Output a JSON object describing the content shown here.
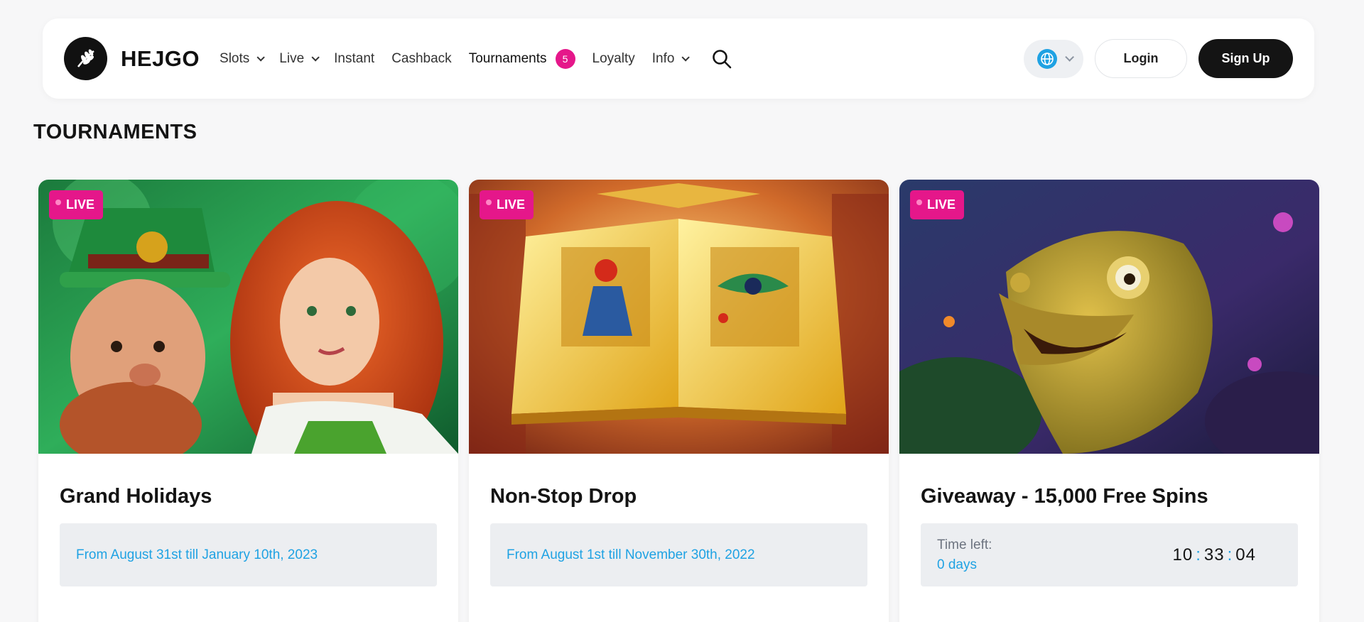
{
  "header": {
    "logo_text": "HEJGO",
    "nav": [
      {
        "label": "Slots",
        "dropdown": true
      },
      {
        "label": "Live",
        "dropdown": true
      },
      {
        "label": "Instant",
        "dropdown": false
      },
      {
        "label": "Cashback",
        "dropdown": false
      },
      {
        "label": "Tournaments",
        "dropdown": false,
        "badge": "5"
      },
      {
        "label": "Loyalty",
        "dropdown": false
      },
      {
        "label": "Info",
        "dropdown": true
      }
    ],
    "login_label": "Login",
    "signup_label": "Sign Up"
  },
  "page_title": "TOURNAMENTS",
  "cards": [
    {
      "badge": "LIVE",
      "title": "Grand Holidays",
      "date_range": "From August 31st till January 10th, 2023",
      "image": "leprechaun-and-red-haired-woman"
    },
    {
      "badge": "LIVE",
      "title": "Non-Stop Drop",
      "date_range": "From August 1st till November 30th, 2022",
      "image": "golden-egyptian-book"
    },
    {
      "badge": "LIVE",
      "title": "Giveaway - 15,000 Free Spins",
      "time_left_label": "Time left:",
      "days": "0 days",
      "hours": "10",
      "minutes": "33",
      "seconds": "04",
      "image": "golden-chameleon"
    }
  ],
  "colors": {
    "accent_pink": "#e5178a",
    "accent_blue": "#1fa2e3",
    "dark": "#141414"
  }
}
